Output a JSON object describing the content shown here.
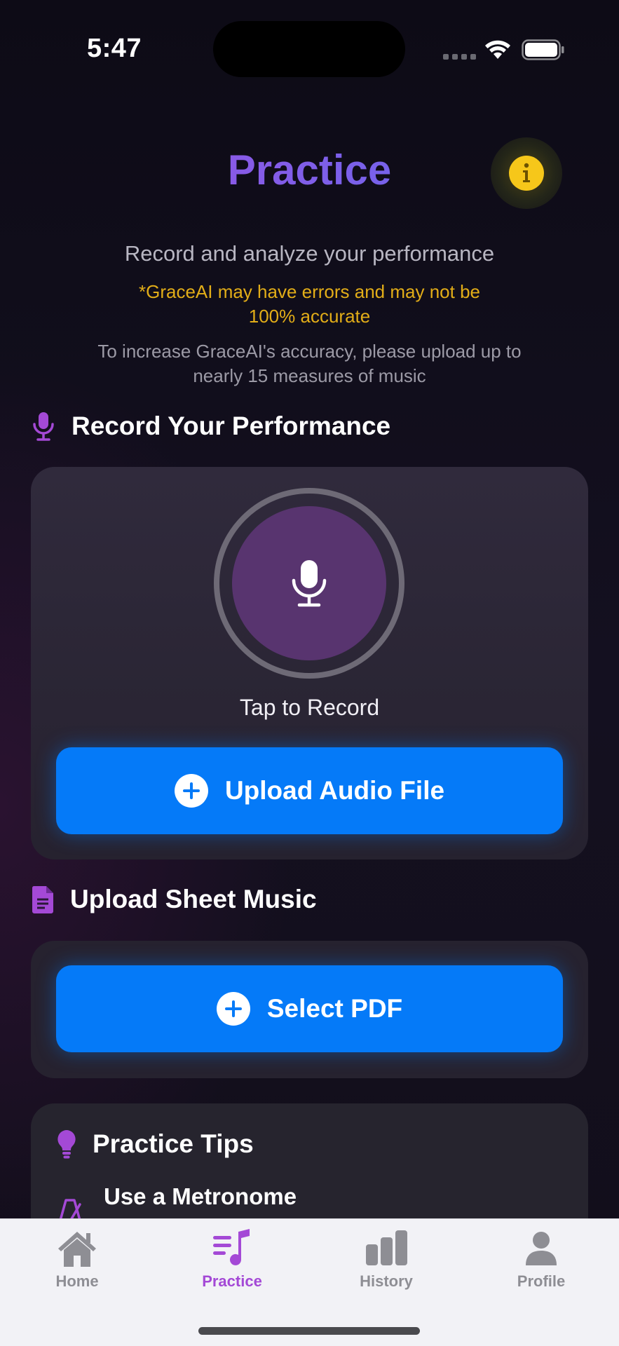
{
  "status_bar": {
    "time": "5:47"
  },
  "header": {
    "title": "Practice"
  },
  "intro": {
    "subtitle": "Record and analyze your performance",
    "warning_line1": "*GraceAI may have errors and may not be",
    "warning_line2": "100% accurate",
    "hint_line1": "To increase GraceAI's accuracy, please upload up to",
    "hint_line2": "nearly 15 measures of music"
  },
  "record_section": {
    "title": "Record Your Performance",
    "tap_label": "Tap to Record",
    "upload_button": "Upload Audio File"
  },
  "sheet_section": {
    "title": "Upload Sheet Music",
    "select_button": "Select PDF"
  },
  "tips_section": {
    "title": "Practice Tips",
    "items": [
      {
        "title": "Use a Metronome"
      }
    ]
  },
  "tabbar": {
    "active": "Practice",
    "items": [
      {
        "label": "Home",
        "icon": "house-icon"
      },
      {
        "label": "Practice",
        "icon": "music-list-icon"
      },
      {
        "label": "History",
        "icon": "bar-chart-icon"
      },
      {
        "label": "Profile",
        "icon": "person-icon"
      }
    ]
  },
  "colors": {
    "accent_purple": "#a449d6",
    "button_blue": "#057af8",
    "warning_yellow": "#e2ad18",
    "info_yellow": "#f6c71a"
  }
}
